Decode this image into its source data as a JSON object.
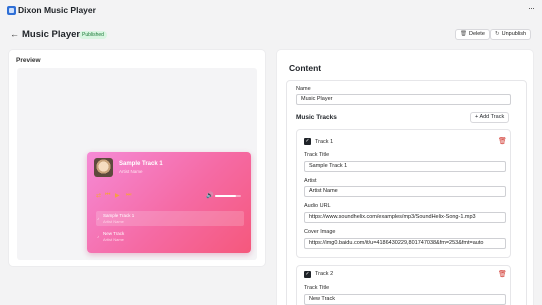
{
  "app": {
    "title": "Dixon Music Player",
    "menu_glyph": "···"
  },
  "header": {
    "back_glyph": "←",
    "title": "Music Player",
    "status_badge": "Published",
    "delete_label": "Delete",
    "unpublish_label": "Unpublish"
  },
  "preview": {
    "label": "Preview",
    "player": {
      "current_title": "Sample Track 1",
      "current_artist": "Artist Name",
      "volume_fraction": 0.8,
      "accent_color": "#f5a044",
      "playlist": [
        {
          "title": "Sample Track 1",
          "artist": "Artist Name",
          "active": true
        },
        {
          "title": "New Track",
          "artist": "Artist Name",
          "active": false
        }
      ]
    }
  },
  "content": {
    "title": "Content",
    "name_label": "Name",
    "name_value": "Music Player",
    "tracks_heading": "Music Tracks",
    "add_track_label": "Add Track",
    "tracks": [
      {
        "header": "Track 1",
        "title_label": "Track Title",
        "title_value": "Sample Track 1",
        "artist_label": "Artist",
        "artist_value": "Artist Name",
        "audio_label": "Audio URL",
        "audio_value": "https://www.soundhelix.com/examples/mp3/SoundHelix-Song-1.mp3",
        "cover_label": "Cover Image",
        "cover_value": "https://img0.baidu.com/it/u=4186430229,801747038&fm=253&fmt=auto"
      },
      {
        "header": "Track 2",
        "title_label": "Track Title",
        "title_value": "New Track"
      }
    ]
  }
}
